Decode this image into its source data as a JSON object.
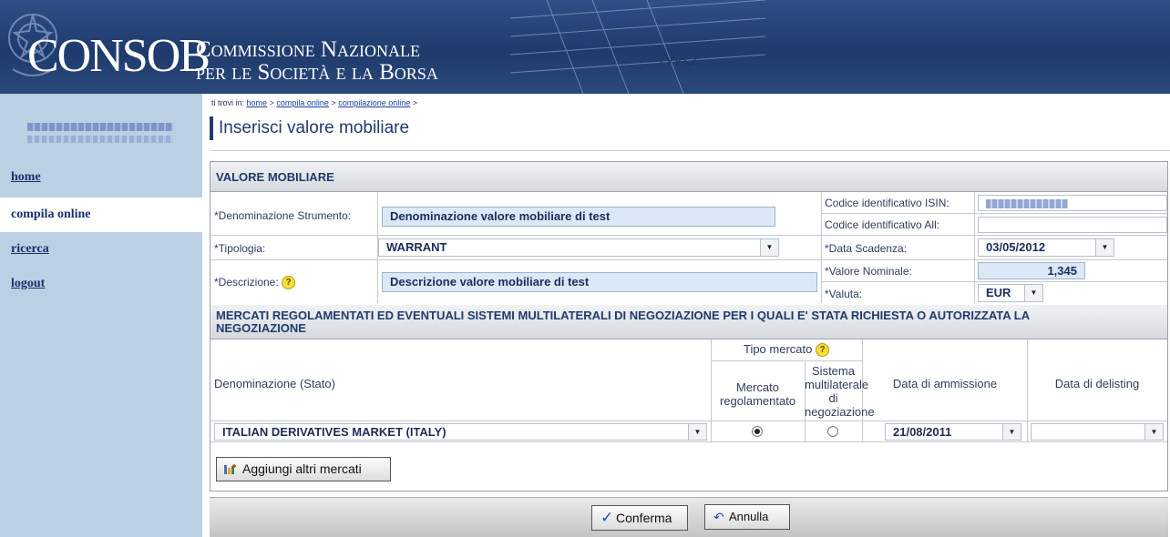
{
  "header": {
    "logo_main": "CONSOB",
    "logo_sub_line1": "Commissione Nazionale",
    "logo_sub_line2": "per le Società e la Borsa"
  },
  "sidebar": {
    "items": [
      {
        "label": "home",
        "active": false
      },
      {
        "label": "compila online",
        "active": true
      },
      {
        "label": "ricerca",
        "active": false
      },
      {
        "label": "logout",
        "active": false
      }
    ]
  },
  "breadcrumb": {
    "prefix": "ti trovi in:",
    "links": [
      "home",
      "compila online",
      "compilazione online"
    ],
    "separator": ">"
  },
  "page": {
    "title": "Inserisci valore mobiliare"
  },
  "valore_mobiliare": {
    "section_title": "VALORE MOBILIARE",
    "denominazione_label": "*Denominazione Strumento:",
    "denominazione_value": "Denominazione valore mobiliare di test",
    "tipologia_label": "*Tipologia:",
    "tipologia_value": "WARRANT",
    "descrizione_label": "*Descrizione:",
    "descrizione_value": "Descrizione valore mobiliare di test",
    "isin_label": "Codice identificativo ISIN:",
    "isin_value": "",
    "all_label": "Codice identificativo All:",
    "all_value": "",
    "scadenza_label": "*Data Scadenza:",
    "scadenza_value": "03/05/2012",
    "nominale_label": "*Valore Nominale:",
    "nominale_value": "1,345",
    "valuta_label": "*Valuta:",
    "valuta_value": "EUR"
  },
  "mercati": {
    "section_title_line1": "MERCATI REGOLAMENTATI ED EVENTUALI SISTEMI MULTILATERALI DI NEGOZIAZIONE PER I QUALI E' STATA RICHIESTA O AUTORIZZATA LA",
    "section_title_line2": "NEGOZIAZIONE",
    "col_denominazione": "Denominazione (Stato)",
    "col_tipo": "Tipo mercato",
    "col_regolamentato": "Mercato regolamentato",
    "col_sistema": "Sistema multilaterale di negoziazione",
    "col_ammissione": "Data di ammissione",
    "col_delisting": "Data di delisting",
    "rows": [
      {
        "denominazione": "ITALIAN DERIVATIVES MARKET (ITALY)",
        "regolamentato": true,
        "ammissione": "21/08/2011",
        "delisting": ""
      }
    ],
    "add_button": "Aggiungi altri mercati"
  },
  "footer": {
    "confirm_label": "Conferma",
    "cancel_label": "Annulla"
  },
  "icons": {
    "help": "question-circle-icon",
    "dropdown": "chevron-down-icon",
    "check": "checkmark-icon",
    "undo": "undo-arrow-icon",
    "add": "add-market-icon"
  }
}
